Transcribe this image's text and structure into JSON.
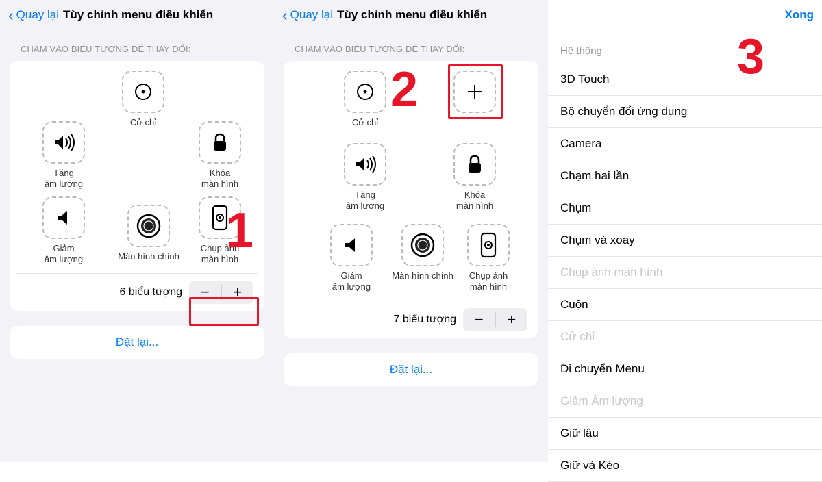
{
  "panel1": {
    "back": "Quay lại",
    "title": "Tùy chỉnh menu điều khiển",
    "subheader": "CHẠM VÀO BIỂU TƯỢNG ĐỂ THAY ĐỔI:",
    "controls": {
      "gesture": "Cử chỉ",
      "volup1": "Tăng",
      "volup2": "âm lượng",
      "lock1": "Khóa",
      "lock2": "màn hình",
      "voldown1": "Giảm",
      "voldown2": "âm lượng",
      "home": "Màn hình chính",
      "screenshot1": "Chụp ảnh",
      "screenshot2": "màn hình"
    },
    "count": "6 biểu tượng",
    "reset": "Đặt lại...",
    "num": "1"
  },
  "panel2": {
    "back": "Quay lại",
    "title": "Tùy chỉnh menu điều khiển",
    "subheader": "CHẠM VÀO BIỂU TƯỢNG ĐỂ THAY ĐỔI:",
    "controls": {
      "gesture": "Cử chỉ",
      "volup1": "Tăng",
      "volup2": "âm lượng",
      "lock1": "Khóa",
      "lock2": "màn hình",
      "voldown1": "Giảm",
      "voldown2": "âm lượng",
      "home": "Màn hình chính",
      "screenshot1": "Chụp ảnh",
      "screenshot2": "màn hình"
    },
    "count": "7 biểu tượng",
    "reset": "Đặt lại...",
    "num": "2"
  },
  "panel3": {
    "done": "Xong",
    "section": "Hệ thống",
    "num": "3",
    "items": [
      {
        "label": "3D Touch",
        "disabled": false
      },
      {
        "label": "Bộ chuyển đổi ứng dụng",
        "disabled": false
      },
      {
        "label": "Camera",
        "disabled": false
      },
      {
        "label": "Chạm hai lần",
        "disabled": false
      },
      {
        "label": "Chụm",
        "disabled": false
      },
      {
        "label": "Chụm và xoay",
        "disabled": false
      },
      {
        "label": "Chụp ảnh màn hình",
        "disabled": true
      },
      {
        "label": "Cuộn",
        "disabled": false
      },
      {
        "label": "Cử chỉ",
        "disabled": true
      },
      {
        "label": "Di chuyển Menu",
        "disabled": false
      },
      {
        "label": "Giảm Âm lượng",
        "disabled": true
      },
      {
        "label": "Giữ lâu",
        "disabled": false
      },
      {
        "label": "Giữ và Kéo",
        "disabled": false
      }
    ]
  }
}
